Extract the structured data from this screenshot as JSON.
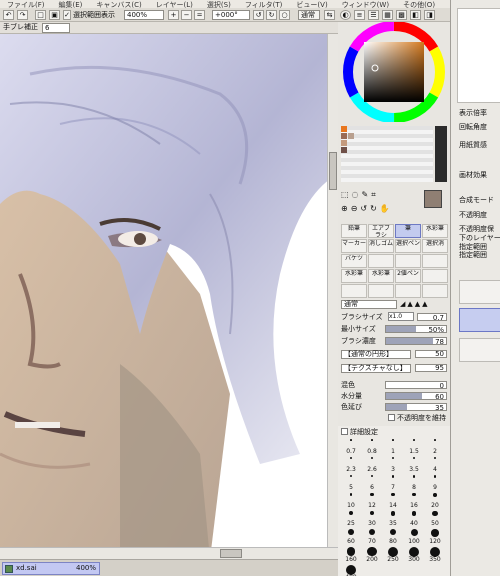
{
  "menubar": {
    "items": [
      "ファイル(F)",
      "編集(E)",
      "キャンバス(C)",
      "レイヤー(L)",
      "選択(S)",
      "フィルタ(T)",
      "ビュー(V)",
      "ウィンドウ(W)",
      "その他(O)"
    ]
  },
  "toolbar": {
    "selection_display_label": "選択範囲表示",
    "zoom_value": "400%",
    "rotation_value": "+000°",
    "normal_button": "通常"
  },
  "subbar": {
    "stabilizer_label": "手ブレ補正",
    "stabilizer_value": "6"
  },
  "color_panel": {
    "accent": "#d47a1f"
  },
  "brushes": {
    "rows": [
      [
        "鉛筆",
        "エアブラシ",
        "筆",
        "水彩筆"
      ],
      [
        "マーカー",
        "消しゴム",
        "選択ペン",
        "選択消"
      ],
      [
        "バケツ",
        "",
        "",
        ""
      ],
      [
        "水彩筆",
        "水彩筆",
        "2値ペン",
        ""
      ],
      [
        "",
        "",
        "",
        ""
      ]
    ],
    "selected": "筆"
  },
  "brush_settings": {
    "blend_mode": "通常",
    "brush_size_label": "ブラシサイズ",
    "brush_size_mult": "x1.0",
    "brush_size_value": "0.7",
    "min_size_label": "最小サイズ",
    "min_size_value": "50%",
    "density_label": "ブラシ濃度",
    "density_value": "78",
    "shape_label": "【通常の円形】",
    "shape_strength": "50",
    "texture_label": "【テクスチャなし】",
    "texture_strength": "95",
    "mix_label": "混色",
    "mix_value": "0",
    "water_label": "水分量",
    "water_value": "60",
    "persistence_label": "色延び",
    "persistence_value": "35",
    "keep_opacity_label": "不透明度を維持",
    "advanced_label": "詳細設定"
  },
  "brush_sizes": [
    "0.7",
    "0.8",
    "1",
    "1.5",
    "2",
    "2.3",
    "2.6",
    "3",
    "3.5",
    "4",
    "5",
    "6",
    "7",
    "8",
    "9",
    "10",
    "12",
    "14",
    "16",
    "20",
    "25",
    "30",
    "35",
    "40",
    "50",
    "60",
    "70",
    "80",
    "100",
    "120",
    "160",
    "200",
    "250",
    "300",
    "350",
    "400"
  ],
  "status": {
    "document_name": "xd.sai",
    "document_zoom": "400%"
  },
  "right_panel": {
    "texts": [
      "表示倍率",
      "回転角度",
      "用紙質感",
      "画材効果",
      "合成モード",
      "不透明度",
      "不透明度保",
      "下のレイヤー",
      "指定範囲",
      "指定範囲"
    ]
  }
}
